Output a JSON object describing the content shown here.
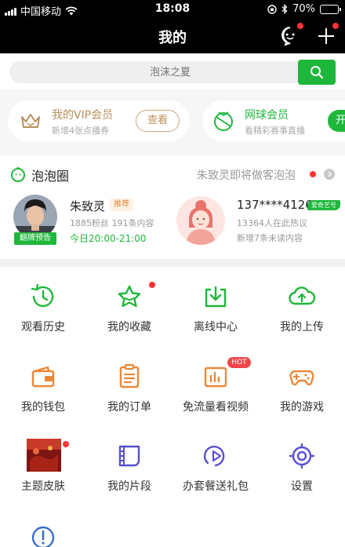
{
  "status_bar": {
    "carrier": "中国移动",
    "time": "18:08",
    "battery": "70%",
    "battery_level": 0.7
  },
  "header": {
    "title": "我的",
    "icons": [
      "message-icon",
      "plus-icon"
    ]
  },
  "search": {
    "placeholder": "泡沫之夏",
    "button_icon": "search-icon"
  },
  "vip_card": {
    "title": "我的VIP会员",
    "subtitle": "新增4张点播券",
    "button": "查看",
    "icon": "crown-icon"
  },
  "tennis_card": {
    "title": "网球会员",
    "subtitle": "看精彩赛事直播",
    "button": "开",
    "icon": "tennis-icon"
  },
  "bubble_circle": {
    "title": "泡泡圈",
    "hint": "朱致灵即将做客泡泡",
    "star": {
      "name": "朱致灵",
      "badge": "推荐",
      "stats": "1885粉丝 191条内容",
      "time": "今日20:00-21:00",
      "tag": "翻牌预告"
    },
    "user": {
      "name": "137****4126",
      "badge": "爱奇艺号",
      "discussion": "13364人在此热议",
      "unread": "新增7条未读内容"
    }
  },
  "grid": [
    {
      "label": "观看历史",
      "icon": "history-clock-icon"
    },
    {
      "label": "我的收藏",
      "icon": "star-icon",
      "dot": true
    },
    {
      "label": "离线中心",
      "icon": "download-icon"
    },
    {
      "label": "我的上传",
      "icon": "cloud-upload-icon"
    },
    {
      "label": "我的钱包",
      "icon": "wallet-icon"
    },
    {
      "label": "我的订单",
      "icon": "order-icon"
    },
    {
      "label": "免流量看视频",
      "icon": "data-free-icon",
      "badge": "HOT"
    },
    {
      "label": "我的游戏",
      "icon": "gamepad-icon"
    },
    {
      "label": "主题皮肤",
      "icon": "theme-icon",
      "dot": true
    },
    {
      "label": "我的片段",
      "icon": "film-clip-icon"
    },
    {
      "label": "办套餐送礼包",
      "icon": "play-circle-icon"
    },
    {
      "label": "设置",
      "icon": "settings-icon"
    },
    {
      "label": "",
      "icon": "feedback-icon"
    }
  ],
  "colors": {
    "brand_green": "#1fb73b",
    "vip_gold": "#b9905c",
    "hot_red": "#f0464a",
    "icon_orange": "#e8893a",
    "icon_purple": "#5a4fd0"
  }
}
